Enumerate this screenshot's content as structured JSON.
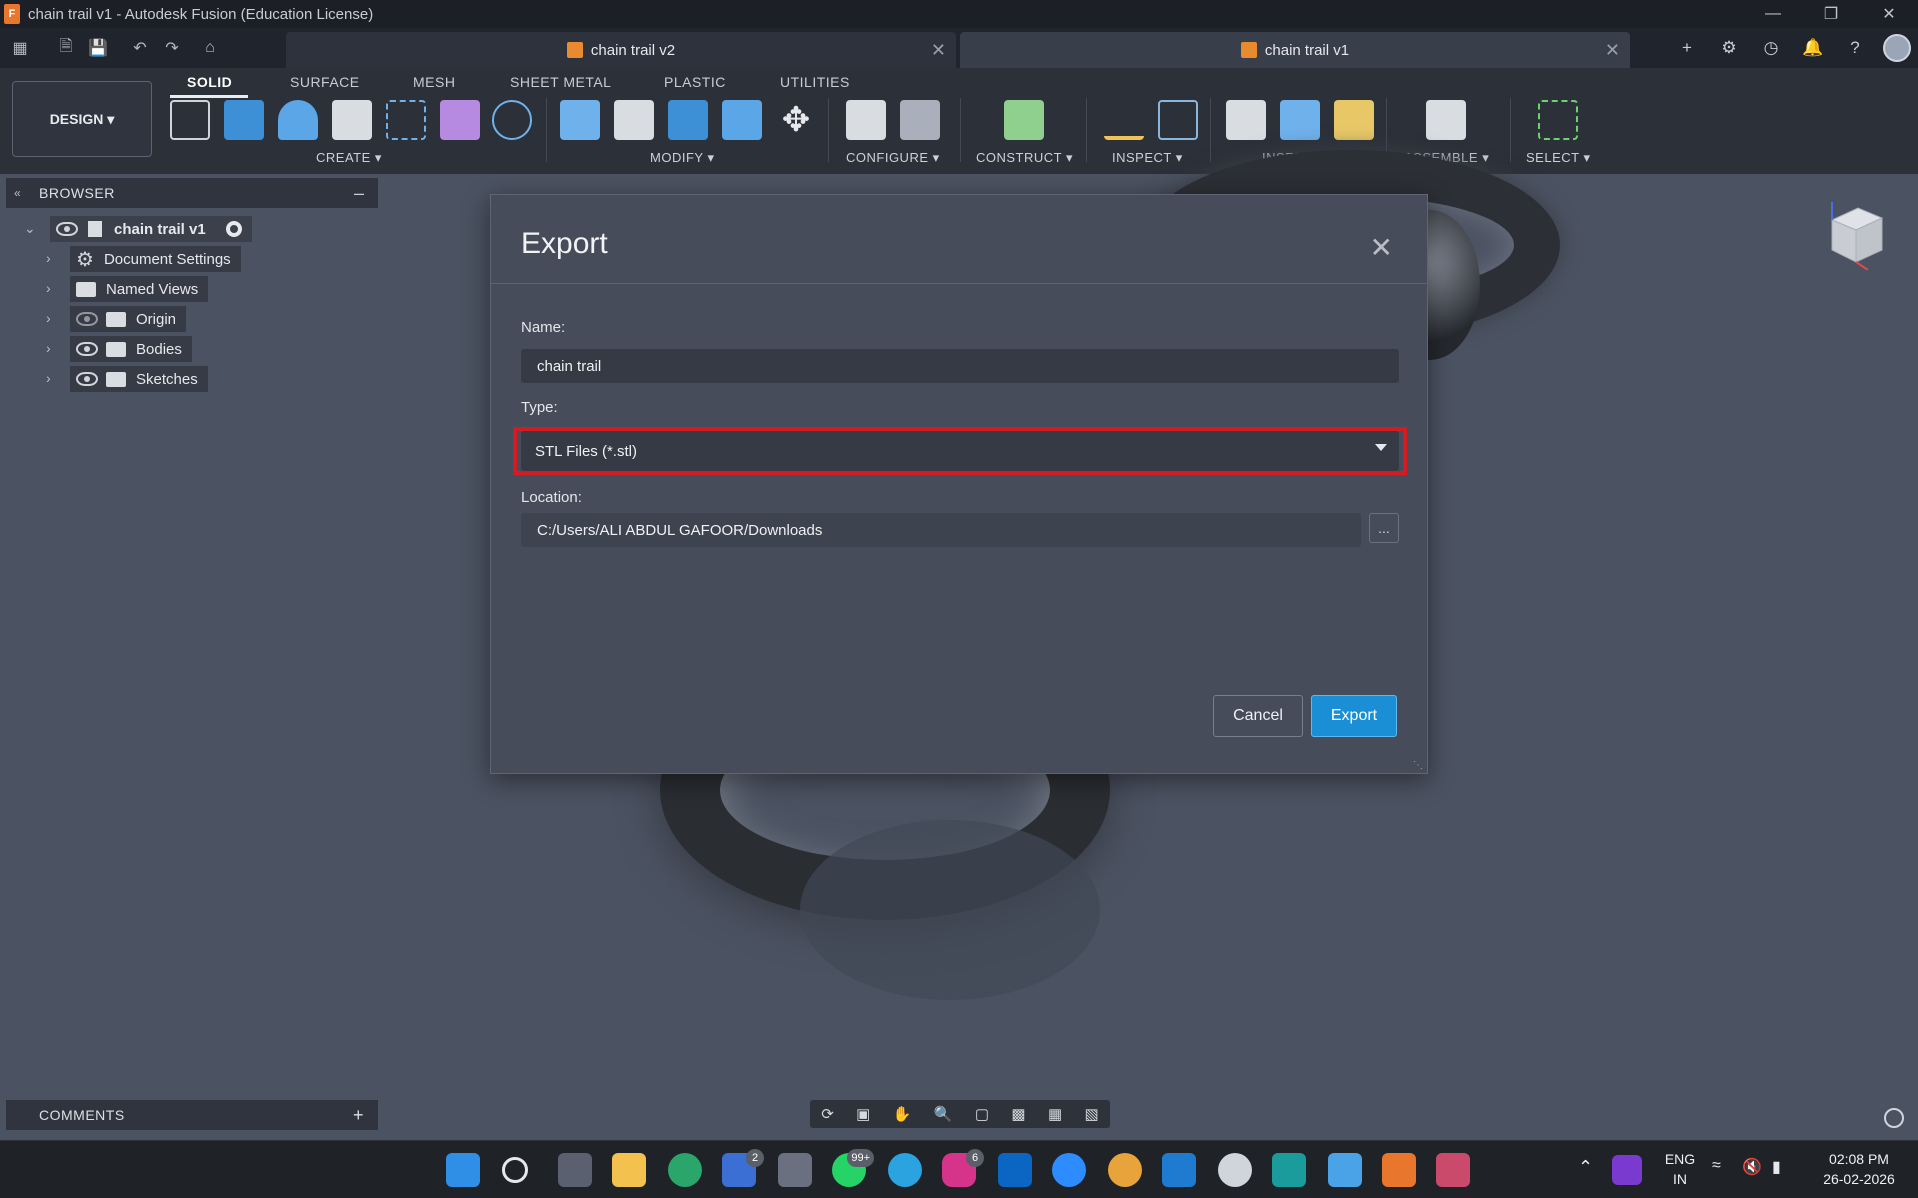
{
  "window": {
    "title": "chain trail v1 - Autodesk Fusion (Education License)",
    "logo": "F"
  },
  "tabs": [
    {
      "label": "chain trail v2",
      "active": false
    },
    {
      "label": "chain trail v1",
      "active": true
    }
  ],
  "toolbar": {
    "design_label": "DESIGN",
    "workspace_tabs": [
      "SOLID",
      "SURFACE",
      "MESH",
      "SHEET METAL",
      "PLASTIC",
      "UTILITIES"
    ],
    "groups": [
      "CREATE",
      "MODIFY",
      "CONFIGURE",
      "CONSTRUCT",
      "INSPECT",
      "INSERT",
      "ASSEMBLE",
      "SELECT"
    ]
  },
  "browser": {
    "title": "BROWSER",
    "root": "chain trail v1",
    "items": [
      "Document Settings",
      "Named Views",
      "Origin",
      "Bodies",
      "Sketches"
    ]
  },
  "comments": {
    "title": "COMMENTS"
  },
  "dialog": {
    "title": "Export",
    "name_label": "Name:",
    "name_value": "chain trail",
    "type_label": "Type:",
    "type_value": "STL Files (*.stl)",
    "location_label": "Location:",
    "location_value": "C:/Users/ALI ABDUL GAFOOR/Downloads",
    "browse_label": "...",
    "cancel_label": "Cancel",
    "export_label": "Export"
  },
  "taskbar": {
    "badges": {
      "store": "2",
      "whatsapp": "99+",
      "instagram": "6"
    },
    "lang": "ENG",
    "region": "IN",
    "time": "02:08 PM",
    "date": "26-02-2026"
  },
  "colors": {
    "accent": "#1a8fd6",
    "highlight": "#d31b21",
    "viewport": "#4b5261"
  }
}
